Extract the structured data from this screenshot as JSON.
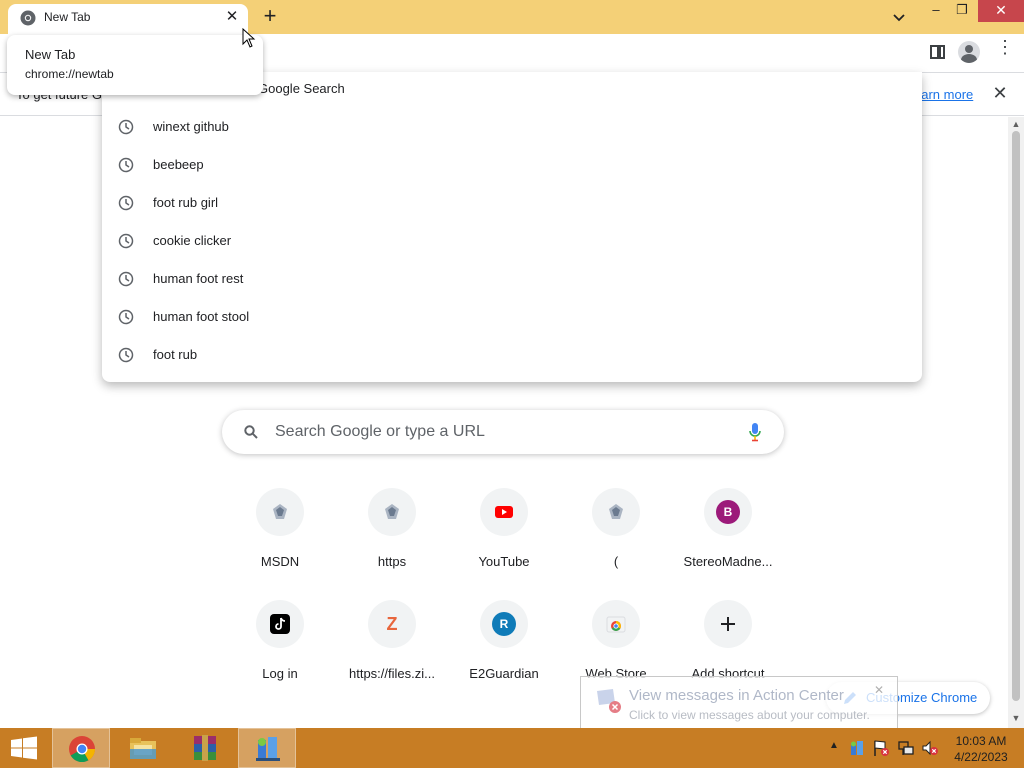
{
  "tab": {
    "title": "New Tab",
    "close_glyph": "✕"
  },
  "new_tab_glyph": "+",
  "window_controls": {
    "minimize": "–",
    "maximize": "❐",
    "close": "✕"
  },
  "tab_hover_card": {
    "title": "New Tab",
    "url": "chrome://newtab"
  },
  "infobar": {
    "text": "To get future G",
    "link": "earn more",
    "close_glyph": "✕"
  },
  "omnibox_dropdown": {
    "partial_top_text": "Google Search",
    "suggestions": [
      {
        "text": "winext github",
        "icon": "history-clock-icon"
      },
      {
        "text": "beebeep",
        "icon": "history-clock-icon"
      },
      {
        "text": "foot rub girl",
        "icon": "history-clock-icon"
      },
      {
        "text": "cookie clicker",
        "icon": "history-clock-icon"
      },
      {
        "text": "human foot rest",
        "icon": "history-clock-icon"
      },
      {
        "text": "human foot stool",
        "icon": "history-clock-icon"
      },
      {
        "text": "foot rub",
        "icon": "history-clock-icon"
      }
    ]
  },
  "search": {
    "placeholder": "Search Google or type a URL"
  },
  "shortcuts": [
    {
      "label": "MSDN",
      "icon": "globe-icon"
    },
    {
      "label": "https",
      "icon": "globe-icon"
    },
    {
      "label": "YouTube",
      "icon": "youtube-icon"
    },
    {
      "label": "(",
      "icon": "globe-icon"
    },
    {
      "label": "StereoMadne...",
      "icon": "letter-icon",
      "letter": "B",
      "color": "#9c1a7a"
    },
    {
      "label": "Log in",
      "icon": "tiktok-icon"
    },
    {
      "label": "https://files.zi...",
      "icon": "letter-icon",
      "letter": "Z",
      "color": "#e8663d"
    },
    {
      "label": "E2Guardian",
      "icon": "letter-icon",
      "letter": "R",
      "color": "#0f7bb8"
    },
    {
      "label": "Web Store",
      "icon": "chrome-web-store-icon"
    },
    {
      "label": "Add shortcut",
      "icon": "plus-icon"
    }
  ],
  "customize": {
    "label": "Customize Chrome"
  },
  "action_center": {
    "title": "View messages in Action Center",
    "subtitle": "Click to view messages about your computer."
  },
  "taskbar": {
    "apps": [
      "chrome-icon",
      "file-explorer-icon",
      "winrar-icon",
      "network-app-icon"
    ],
    "time": "10:03 AM",
    "date": "4/22/2023",
    "tray_arrow": "▲"
  },
  "colors": {
    "titlebar": "#f4d077",
    "taskbar": "#c77d24",
    "link": "#1a73e8"
  }
}
